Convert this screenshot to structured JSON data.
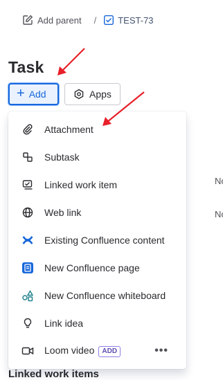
{
  "breadcrumb": {
    "parent_label": "Add parent",
    "separator": "/",
    "issue_key": "TEST-73"
  },
  "page": {
    "title": "Task"
  },
  "toolbar": {
    "add_label": "Add",
    "apps_label": "Apps"
  },
  "menu": {
    "items": [
      {
        "label": "Attachment",
        "icon": "paperclip-icon"
      },
      {
        "label": "Subtask",
        "icon": "subtask-icon"
      },
      {
        "label": "Linked work item",
        "icon": "linked-work-item-icon"
      },
      {
        "label": "Web link",
        "icon": "globe-icon"
      },
      {
        "label": "Existing Confluence content",
        "icon": "confluence-icon"
      },
      {
        "label": "New Confluence page",
        "icon": "confluence-page-icon"
      },
      {
        "label": "New Confluence whiteboard",
        "icon": "whiteboard-icon"
      },
      {
        "label": "Link idea",
        "icon": "lightbulb-icon"
      },
      {
        "label": "Loom video",
        "icon": "video-camera-icon",
        "badge": "ADD",
        "more": "•••"
      }
    ]
  },
  "background": {
    "fragment_1": "No",
    "fragment_2": "No",
    "section_heading": "Linked work items"
  },
  "colors": {
    "accent": "#1868db",
    "annotation_arrow": "#e8202a",
    "confluence_blue": "#1868db"
  }
}
